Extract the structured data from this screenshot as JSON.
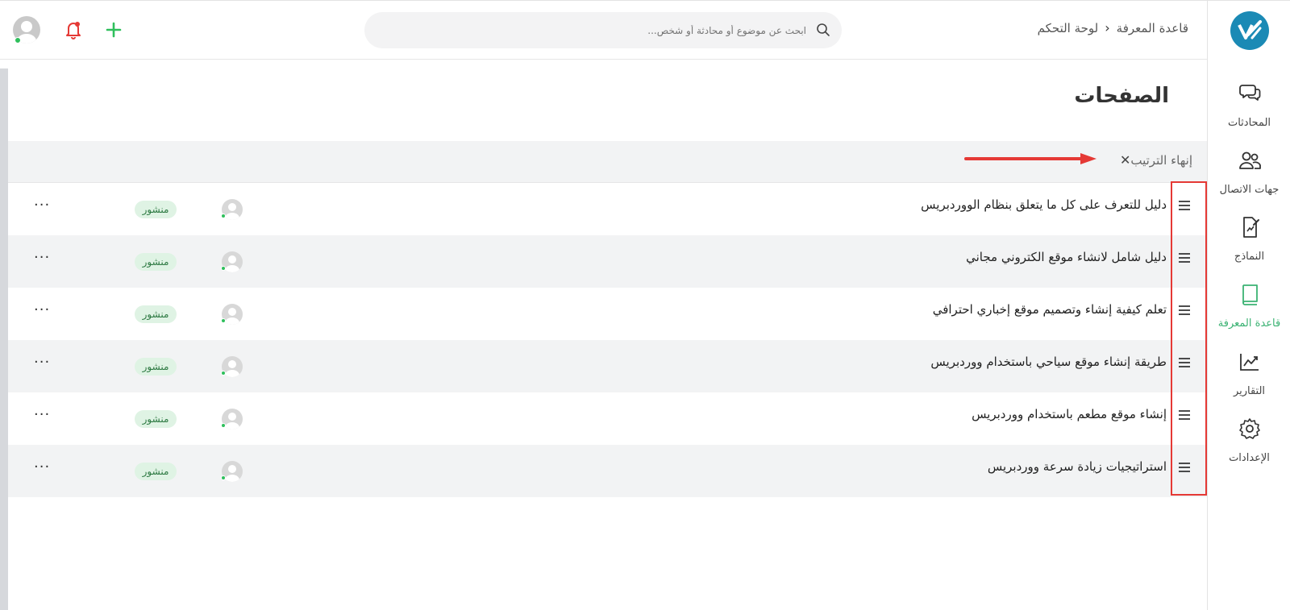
{
  "sidebar": {
    "items": [
      {
        "label": "المحادثات",
        "icon": "chat-icon"
      },
      {
        "label": "جهات الاتصال",
        "icon": "contacts-icon"
      },
      {
        "label": "النماذج",
        "icon": "forms-icon"
      },
      {
        "label": "قاعدة المعرفة",
        "icon": "book-icon",
        "active": true
      },
      {
        "label": "التقارير",
        "icon": "chart-icon"
      },
      {
        "label": "الإعدادات",
        "icon": "gear-icon"
      }
    ]
  },
  "header": {
    "breadcrumb": [
      "لوحة التحكم",
      "قاعدة المعرفة"
    ],
    "search_placeholder": "ابحث عن موضوع أو محادثة أو شخص..."
  },
  "main": {
    "title": "الصفحات",
    "end_sort_label": "إنهاء الترتيب",
    "rows": [
      {
        "title": "دليل للتعرف على كل ما يتعلق بنظام الووردبريس",
        "status": "منشور"
      },
      {
        "title": "دليل شامل لانشاء موقع الكتروني مجاني",
        "status": "منشور"
      },
      {
        "title": "تعلم كيفية إنشاء وتصميم موقع إخباري احترافي",
        "status": "منشور"
      },
      {
        "title": "طريقة إنشاء موقع سياحي باستخدام ووردبريس",
        "status": "منشور"
      },
      {
        "title": "إنشاء موقع مطعم باستخدام ووردبريس",
        "status": "منشور"
      },
      {
        "title": "استراتيجيات زيادة سرعة ووردبريس",
        "status": "منشور"
      }
    ],
    "more_label": "···"
  },
  "colors": {
    "accent": "#3bb273",
    "logo": "#1b8ab5",
    "bell": "#e53935",
    "annotation": "#e53935",
    "badge_bg": "#dff3e4"
  }
}
